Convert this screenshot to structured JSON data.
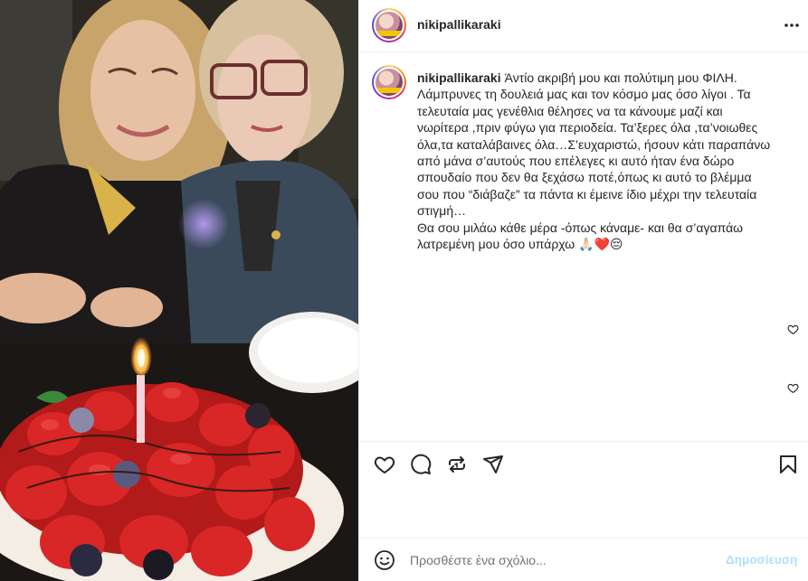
{
  "post": {
    "username": "nikipallikaraki",
    "caption_text": "Άντίο ακριβή μου και πολύτιμη μου ΦΙΛΗ.\nΛάμπρυνες τη δουλειά μας και τον κόσμο μας όσο λίγοι . Τα\nτελευταία μας γενέθλια θέλησες να τα κάνουμε μαζί και\nνωρίτερα ,πριν φύγω για περιοδεία. Τα’ξερες όλα ,τα’νοιωθες\nόλα,τα καταλάβαινες όλα…Σ’ευχαριστώ, ήσουν κάτι παραπάνω\nαπό μάνα σ’αυτούς που επέλεγες κι αυτό ήταν ένα δώρο\nσπουδαίο που δεν θα ξεχάσω ποτέ,όπως κι αυτό το βλέμμα\nσου που “διάβαζε” τα πάντα κι έμεινε ίδιο μέχρι την τελευταία\nστιγμή…\nΘα σου μιλάω κάθε μέρα -όπως κάναμε- και θα σ’αγαπάω\nλατρεμένη μου όσο υπάρχω 🙏🏻❤️😔"
  },
  "icons": {
    "more": "more-options-icon",
    "like": "heart-icon",
    "comment": "comment-icon",
    "repost": "repost-icon",
    "share": "share-icon",
    "save": "bookmark-icon",
    "emoji": "emoji-icon"
  },
  "comment_box": {
    "placeholder": "Προσθέστε ένα σχόλιο...",
    "post_label": "Δημοσίευση"
  },
  "colors": {
    "text": "#262626",
    "border": "#efefef",
    "post_button_disabled": "#b2dffc",
    "placeholder": "#737373"
  }
}
